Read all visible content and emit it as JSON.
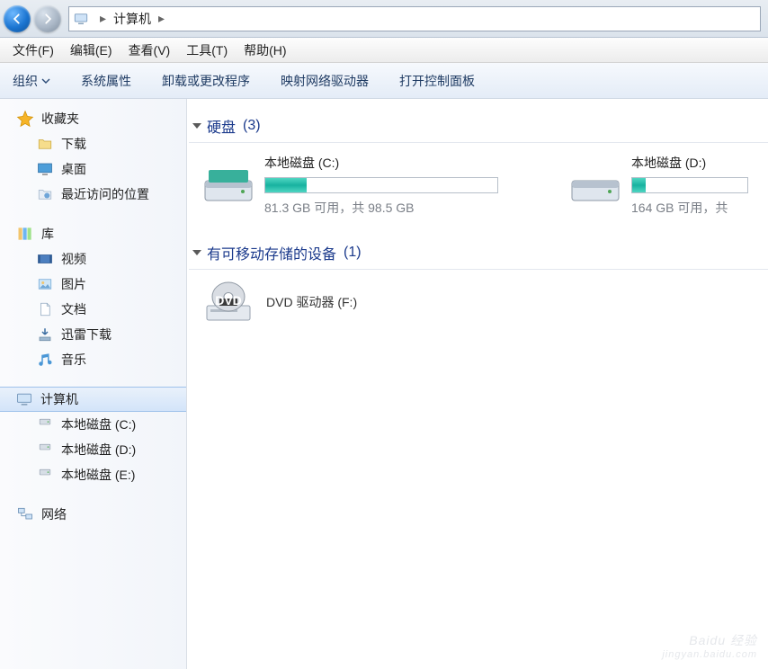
{
  "breadcrumb": {
    "location": "计算机"
  },
  "menus": {
    "file": "文件(F)",
    "edit": "编辑(E)",
    "view": "查看(V)",
    "tools": "工具(T)",
    "help": "帮助(H)"
  },
  "toolbar": {
    "organize": "组织",
    "sysprops": "系统属性",
    "uninstall": "卸载或更改程序",
    "mapdrive": "映射网络驱动器",
    "controlpanel": "打开控制面板"
  },
  "sidebar": {
    "favorites": {
      "label": "收藏夹",
      "items": [
        "下载",
        "桌面",
        "最近访问的位置"
      ]
    },
    "libraries": {
      "label": "库",
      "items": [
        "视频",
        "图片",
        "文档",
        "迅雷下载",
        "音乐"
      ]
    },
    "computer": {
      "label": "计算机",
      "items": [
        "本地磁盘 (C:)",
        "本地磁盘 (D:)",
        "本地磁盘 (E:)"
      ]
    },
    "network": {
      "label": "网络"
    }
  },
  "content": {
    "hdd": {
      "title": "硬盘",
      "count": "(3)",
      "drives": [
        {
          "name": "本地磁盘 (C:)",
          "stats": "81.3 GB 可用，共 98.5 GB",
          "fill_pct": 18
        },
        {
          "name": "本地磁盘 (D:)",
          "stats": "164 GB 可用，共",
          "fill_pct": 12
        }
      ]
    },
    "removable": {
      "title": "有可移动存储的设备",
      "count": "(1)",
      "devices": [
        {
          "name": "DVD 驱动器 (F:)"
        }
      ]
    }
  },
  "watermark": {
    "main": "Baidu 经验",
    "sub": "jingyan.baidu.com"
  }
}
